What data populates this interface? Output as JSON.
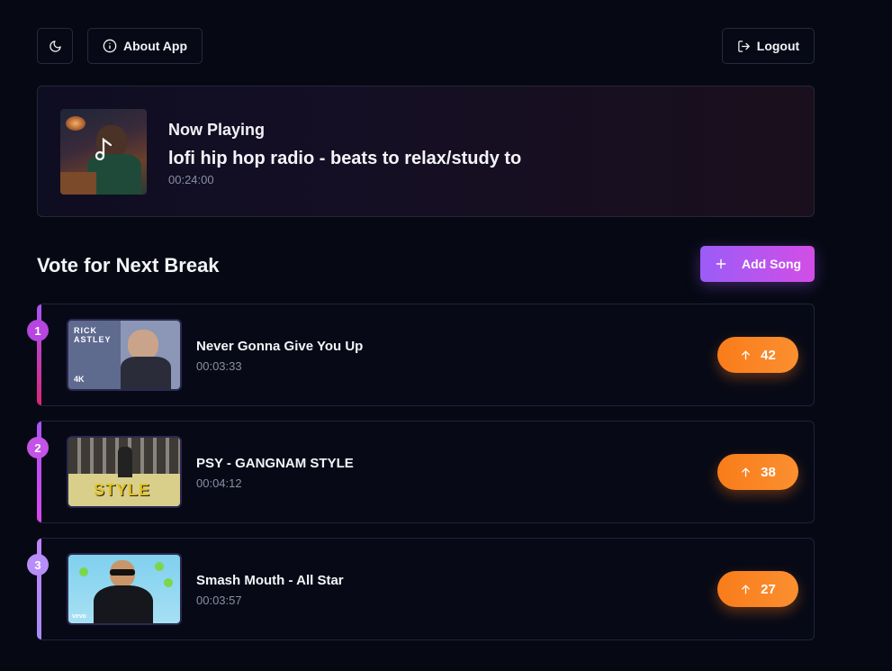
{
  "header": {
    "about_label": "About App",
    "logout_label": "Logout"
  },
  "now_playing": {
    "label": "Now Playing",
    "title": "lofi hip hop radio - beats to relax/study to",
    "duration": "00:24:00"
  },
  "queue": {
    "heading": "Vote for Next Break",
    "add_label": "Add Song",
    "songs": [
      {
        "rank": "1",
        "title": "Never Gonna Give You Up",
        "duration": "00:03:33",
        "votes": "42",
        "thumb_text_line1": "RICK",
        "thumb_text_line2": "ASTLEY",
        "thumb_badge": "4K",
        "stripe_color": "#c026d3"
      },
      {
        "rank": "2",
        "title": "PSY - GANGNAM STYLE",
        "duration": "00:04:12",
        "votes": "38",
        "thumb_text_line1": "STYLE",
        "stripe_color": "#c553e8"
      },
      {
        "rank": "3",
        "title": "Smash Mouth - All Star",
        "duration": "00:03:57",
        "votes": "27",
        "thumb_badge": "vevo",
        "stripe_color": "#a78bfa"
      }
    ]
  },
  "colors": {
    "background": "#060914",
    "accent_purple": "#a855f7",
    "accent_pink": "#d946ef",
    "vote_orange": "#f97c1a"
  }
}
